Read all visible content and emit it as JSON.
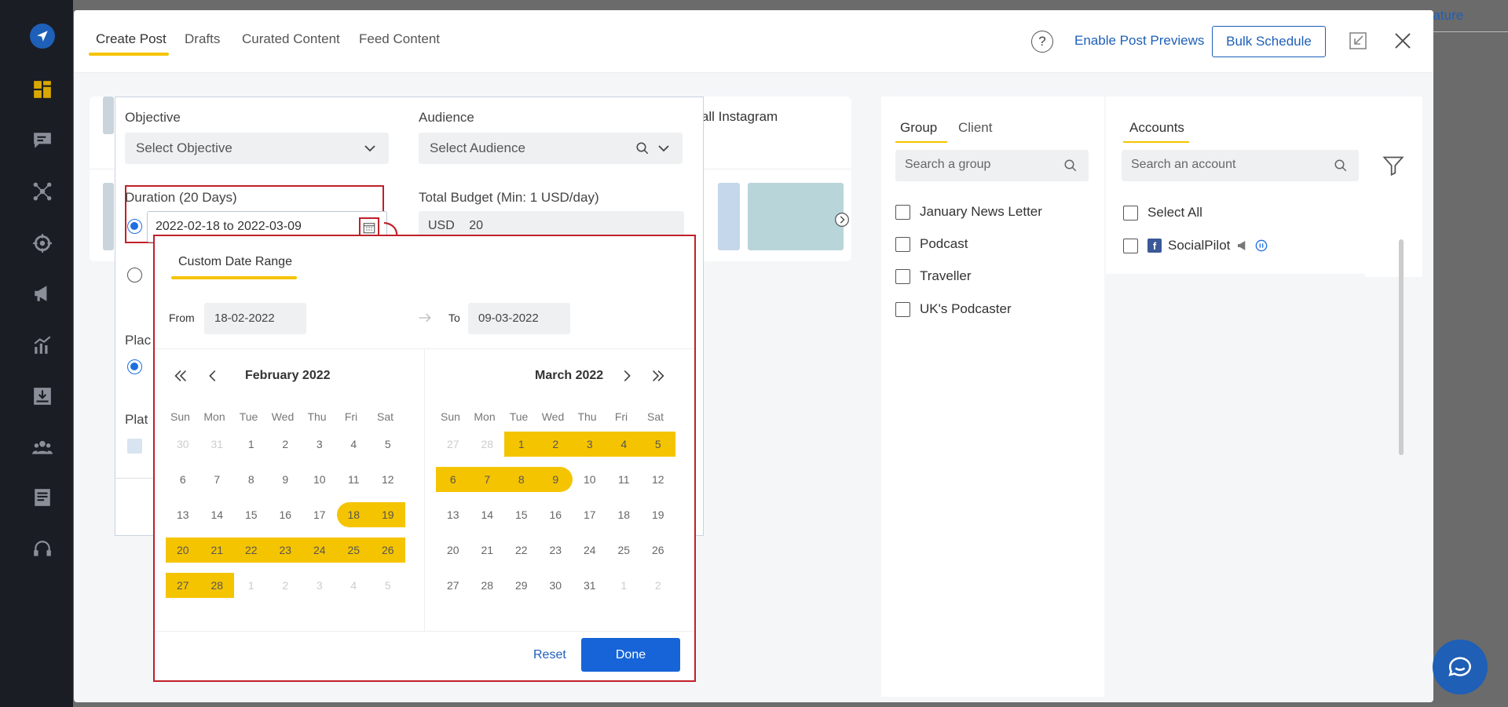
{
  "app": {
    "background_link": "eature",
    "colors": {
      "accent": "#f5c400",
      "primary": "#1e5fb8",
      "highlight": "#c0202a"
    }
  },
  "sidebar": {
    "icons": [
      "logo-icon",
      "dashboard-icon",
      "chat-icon",
      "network-icon",
      "target-icon",
      "megaphone-icon",
      "analytics-icon",
      "download-icon",
      "team-icon",
      "document-icon",
      "support-icon"
    ]
  },
  "header": {
    "tabs": [
      "Create Post",
      "Drafts",
      "Curated Content",
      "Feed Content"
    ],
    "active_tab": "Create Post",
    "help": "?",
    "preview_link": "Enable Post Previews",
    "bulk_button": "Bulk Schedule"
  },
  "form": {
    "objective_label": "Objective",
    "objective_placeholder": "Select Objective",
    "audience_label": "Audience",
    "audience_placeholder": "Select Audience",
    "duration_label": "Duration (20 Days)",
    "duration_value": "2022-02-18 to 2022-03-09",
    "budget_label": "Total Budget (Min: 1 USD/day)",
    "currency": "USD",
    "budget_value": "20",
    "select_instagram": "et all Instagram",
    "partial_placement": "Plac",
    "partial_platform": "Plat"
  },
  "date_picker": {
    "tab": "Custom Date Range",
    "from_label": "From",
    "from_value": "18-02-2022",
    "to_label": "To",
    "to_value": "09-03-2022",
    "weekdays": [
      "Sun",
      "Mon",
      "Tue",
      "Wed",
      "Thu",
      "Fri",
      "Sat"
    ],
    "left_month": {
      "title": "February 2022",
      "weeks": [
        [
          "30",
          "31",
          "1",
          "2",
          "3",
          "4",
          "5"
        ],
        [
          "6",
          "7",
          "8",
          "9",
          "10",
          "11",
          "12"
        ],
        [
          "13",
          "14",
          "15",
          "16",
          "17",
          "18",
          "19"
        ],
        [
          "20",
          "21",
          "22",
          "23",
          "24",
          "25",
          "26"
        ],
        [
          "27",
          "28",
          "1",
          "2",
          "3",
          "4",
          "5"
        ]
      ]
    },
    "right_month": {
      "title": "March 2022",
      "weeks": [
        [
          "27",
          "28",
          "1",
          "2",
          "3",
          "4",
          "5"
        ],
        [
          "6",
          "7",
          "8",
          "9",
          "10",
          "11",
          "12"
        ],
        [
          "13",
          "14",
          "15",
          "16",
          "17",
          "18",
          "19"
        ],
        [
          "20",
          "21",
          "22",
          "23",
          "24",
          "25",
          "26"
        ],
        [
          "27",
          "28",
          "29",
          "30",
          "31",
          "1",
          "2"
        ]
      ]
    },
    "reset": "Reset",
    "done": "Done"
  },
  "groups": {
    "tabs": [
      "Group",
      "Client"
    ],
    "search_placeholder": "Search a group",
    "items": [
      "January News Letter",
      "Podcast",
      "Traveller",
      "UK's Podcaster"
    ]
  },
  "accounts": {
    "tab": "Accounts",
    "search_placeholder": "Search an account",
    "select_all": "Select All",
    "items": [
      {
        "name": "SocialPilot",
        "network": "facebook"
      }
    ]
  }
}
